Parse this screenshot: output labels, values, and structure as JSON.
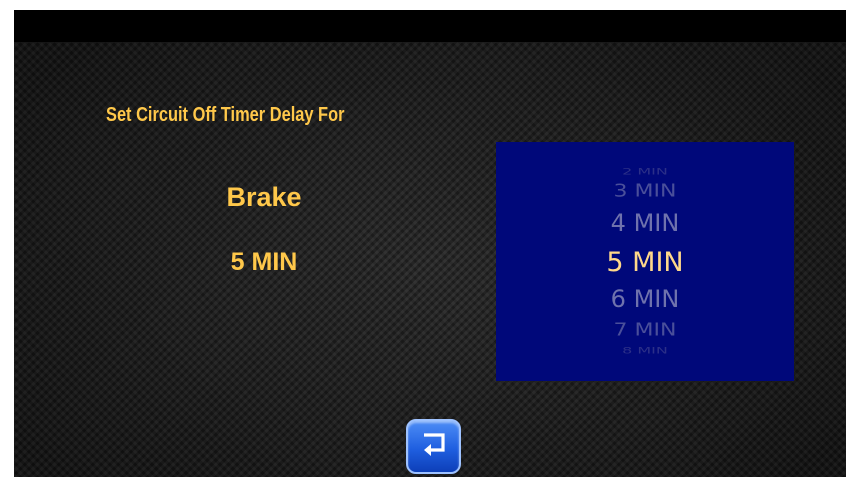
{
  "header": {
    "prompt": "Set Circuit Off Timer Delay For"
  },
  "circuit": {
    "name": "Brake",
    "selected_delay": "5 MIN"
  },
  "picker": {
    "items": [
      "2 MIN",
      "3 MIN",
      "4 MIN",
      "5 MIN",
      "6 MIN",
      "7 MIN",
      "8 MIN"
    ],
    "selected": "5 MIN"
  },
  "footer": {
    "back_icon": "return-arrow-icon"
  },
  "colors": {
    "accent": "#ffc84a",
    "picker_bg": "#00087a",
    "button": "#1f5fe0"
  }
}
